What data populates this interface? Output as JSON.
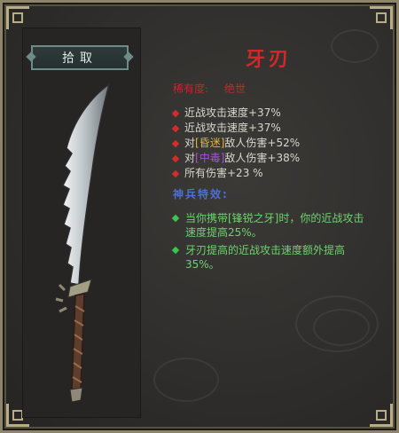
{
  "panel": {
    "pickup_label": "拾取"
  },
  "item": {
    "name": "牙刃",
    "rarity_label": "稀有度:",
    "rarity_value": "绝世",
    "name_color": "#d6262a"
  },
  "stats": [
    {
      "text": "近战攻击速度+37%"
    },
    {
      "text": "近战攻击速度+37%"
    },
    {
      "prefix": "对",
      "keyword": "[昏迷]",
      "keyword_color": "#e0b73a",
      "suffix": "敌人伤害+52%"
    },
    {
      "prefix": "对",
      "keyword": "[中毒]",
      "keyword_color": "#a84fd6",
      "suffix": "敌人伤害+38%"
    },
    {
      "text": "所有伤害+23 %"
    }
  ],
  "set_effects": {
    "title": "神兵特效:",
    "items": [
      "当你携带[锋锐之牙]时，你的近战攻击速度提高25%。",
      "牙刃提高的近战攻击速度额外提高35%。"
    ]
  },
  "icons": {
    "stat_bullet": "red-diamond-icon",
    "effect_bullet": "green-diamond-icon",
    "weapon": "curved-serrated-blade-icon"
  }
}
